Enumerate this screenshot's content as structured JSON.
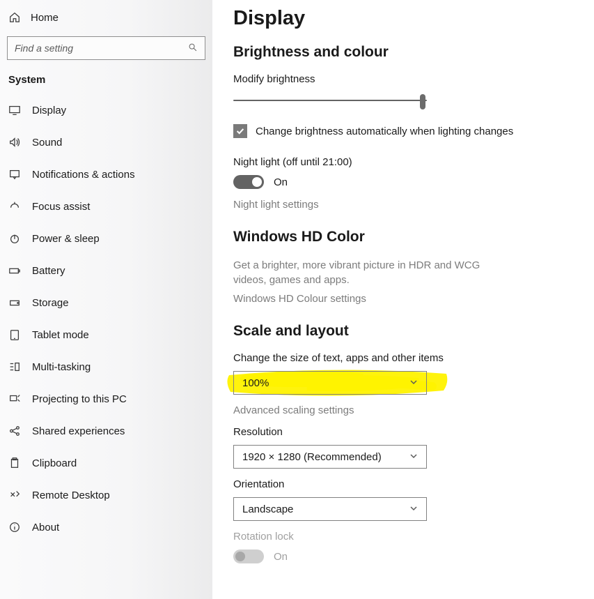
{
  "sidebar": {
    "home": "Home",
    "search_placeholder": "Find a setting",
    "group": "System",
    "items": [
      {
        "label": "Display"
      },
      {
        "label": "Sound"
      },
      {
        "label": "Notifications & actions"
      },
      {
        "label": "Focus assist"
      },
      {
        "label": "Power & sleep"
      },
      {
        "label": "Battery"
      },
      {
        "label": "Storage"
      },
      {
        "label": "Tablet mode"
      },
      {
        "label": "Multi-tasking"
      },
      {
        "label": "Projecting to this PC"
      },
      {
        "label": "Shared experiences"
      },
      {
        "label": "Clipboard"
      },
      {
        "label": "Remote Desktop"
      },
      {
        "label": "About"
      }
    ]
  },
  "main": {
    "title": "Display",
    "brightness": {
      "heading": "Brightness and colour",
      "modify": "Modify brightness",
      "auto_label": "Change brightness automatically when lighting changes",
      "night_label": "Night light (off until 21:00)",
      "toggle_state": "On",
      "night_settings": "Night light settings"
    },
    "hd": {
      "heading": "Windows HD Color",
      "desc": "Get a brighter, more vibrant picture in HDR and WCG videos, games and apps.",
      "link": "Windows HD Colour settings"
    },
    "scale": {
      "heading": "Scale and layout",
      "size_label": "Change the size of text, apps and other items",
      "size_value": "100%",
      "advanced": "Advanced scaling settings",
      "res_label": "Resolution",
      "res_value": "1920 × 1280 (Recommended)",
      "orient_label": "Orientation",
      "orient_value": "Landscape",
      "rotation_label": "Rotation lock",
      "rotation_state": "On"
    }
  }
}
